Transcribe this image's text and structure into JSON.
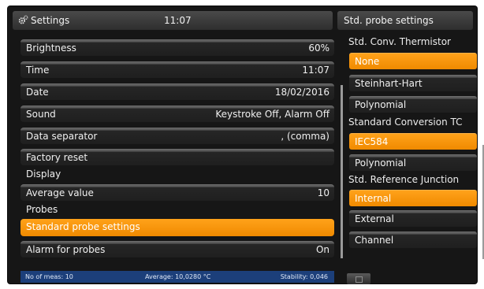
{
  "header": {
    "title": "Settings",
    "time": "11:07",
    "icon": "gear-icon"
  },
  "settings_list": [
    {
      "label": "Brightness",
      "value": "60%",
      "kind": "item"
    },
    {
      "label": "Time",
      "value": "11:07",
      "kind": "item"
    },
    {
      "label": "Date",
      "value": "18/02/2016",
      "kind": "item"
    },
    {
      "label": "Sound",
      "value": "Keystroke Off, Alarm Off",
      "kind": "item"
    },
    {
      "label": "Data separator",
      "value": ", (comma)",
      "kind": "item"
    },
    {
      "label": "Factory reset",
      "value": "",
      "kind": "item"
    },
    {
      "label": "Display",
      "value": "",
      "kind": "section"
    },
    {
      "label": "Average value",
      "value": "10",
      "kind": "item"
    },
    {
      "label": "Probes",
      "value": "",
      "kind": "section"
    },
    {
      "label": "Standard probe settings",
      "value": "",
      "kind": "selected"
    },
    {
      "label": "Alarm for probes",
      "value": "On",
      "kind": "item"
    }
  ],
  "status_bar": {
    "meas": "No of meas: 10",
    "average": "Average: 10,0280 °C",
    "stability": "Stability: 0,046"
  },
  "right_panel": {
    "title": "Std. probe settings",
    "thermistor": {
      "label": "Std. Conv. Thermistor",
      "options": [
        "None",
        "Steinhart-Hart",
        "Polynomial"
      ],
      "selected": "None"
    },
    "tc": {
      "label": "Standard Conversion TC",
      "options": [
        "IEC584",
        "Polynomial"
      ],
      "selected": "IEC584"
    },
    "ref_junction": {
      "label": "Std. Reference Junction",
      "options": [
        "Internal",
        "External",
        "Channel"
      ],
      "selected": "Internal"
    }
  },
  "colors": {
    "accent": "#f7941d",
    "status_bar": "#1c3f7a"
  }
}
